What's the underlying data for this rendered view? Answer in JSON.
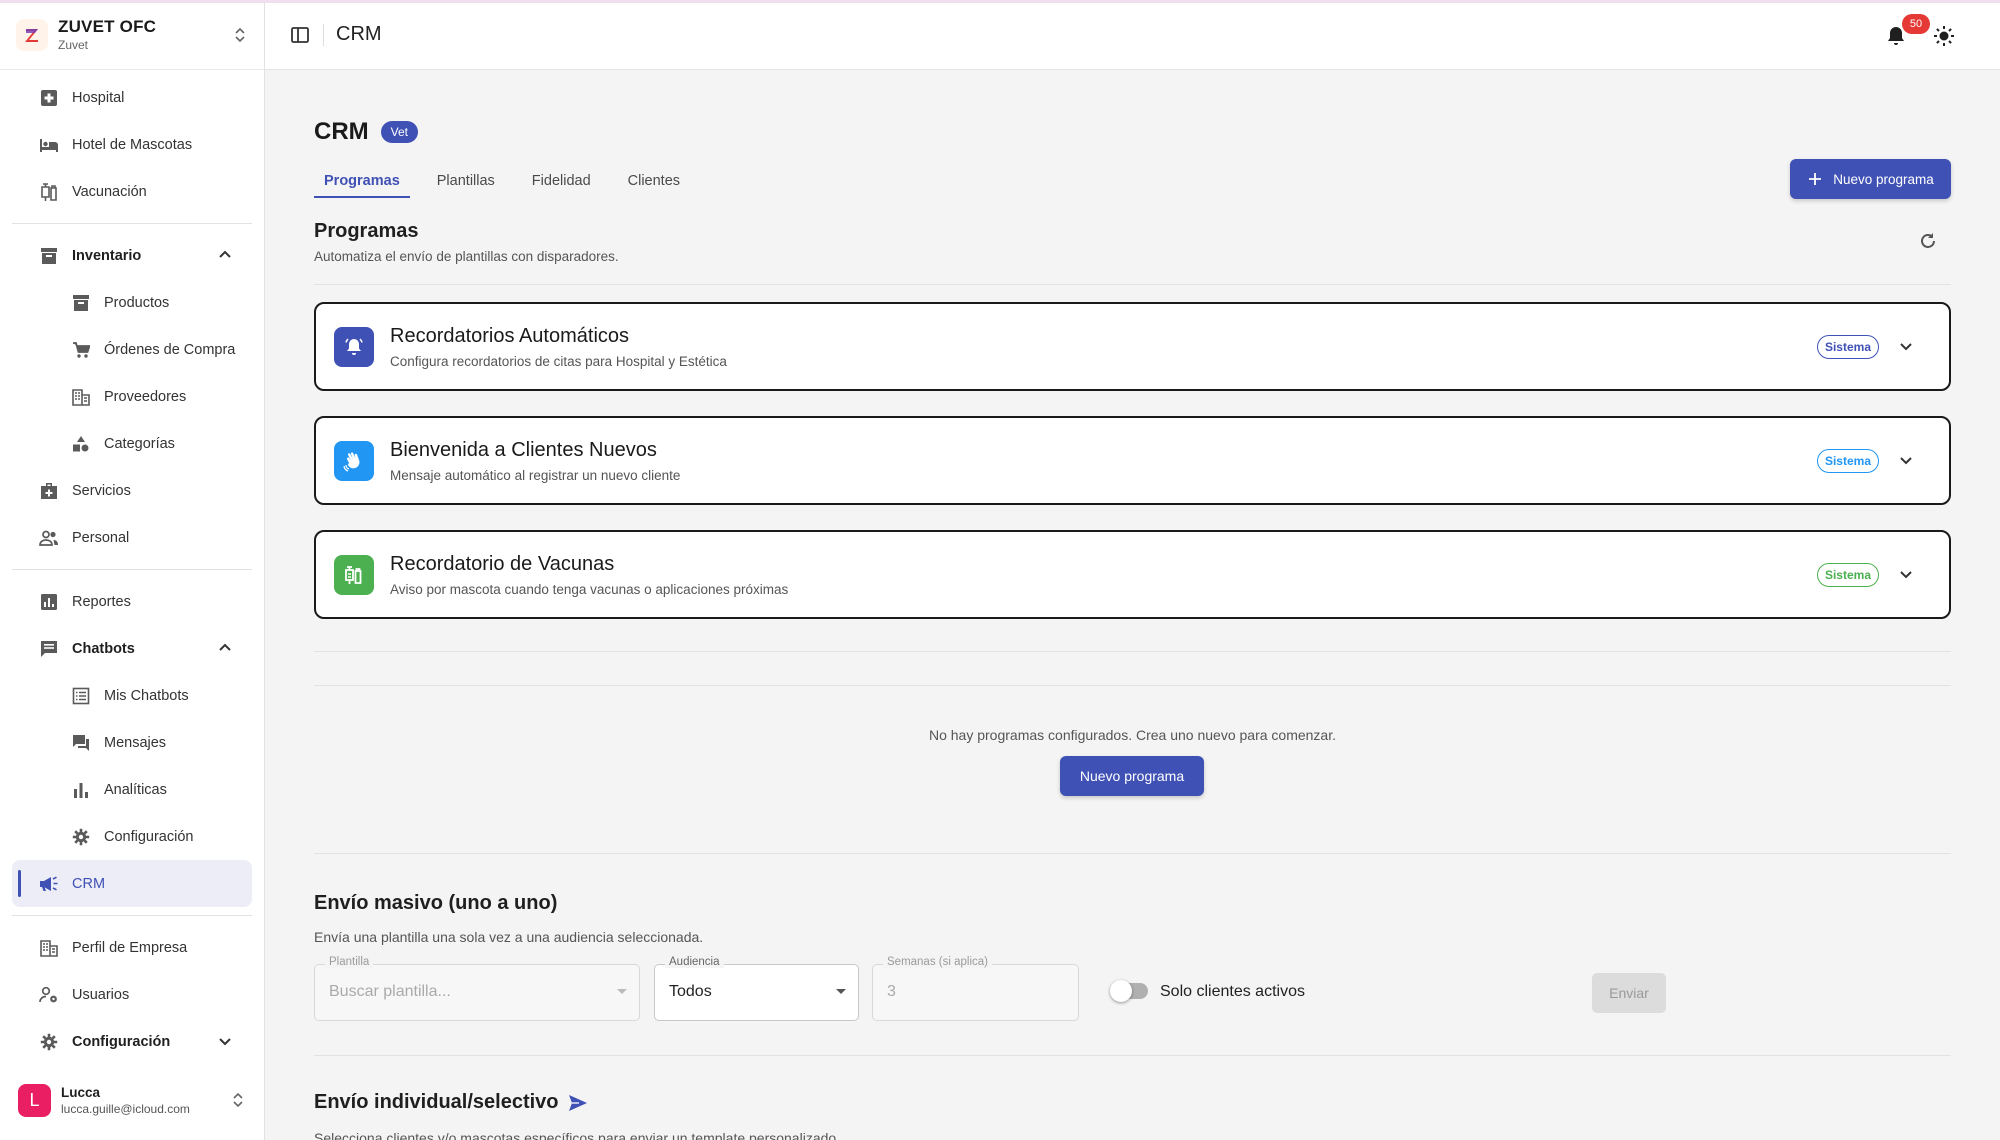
{
  "org": {
    "name": "ZUVET OFC",
    "sub": "Zuvet"
  },
  "sidebar": {
    "items": [
      {
        "label": "Hospital"
      },
      {
        "label": "Hotel de Mascotas"
      },
      {
        "label": "Vacunación"
      },
      {
        "label": "Inventario"
      },
      {
        "label": "Productos"
      },
      {
        "label": "Órdenes de Compra"
      },
      {
        "label": "Proveedores"
      },
      {
        "label": "Categorías"
      },
      {
        "label": "Servicios"
      },
      {
        "label": "Personal"
      },
      {
        "label": "Reportes"
      },
      {
        "label": "Chatbots"
      },
      {
        "label": "Mis Chatbots"
      },
      {
        "label": "Mensajes"
      },
      {
        "label": "Analíticas"
      },
      {
        "label": "Configuración"
      },
      {
        "label": "CRM"
      },
      {
        "label": "Perfil de Empresa"
      },
      {
        "label": "Usuarios"
      },
      {
        "label": "Configuración"
      }
    ]
  },
  "user": {
    "initial": "L",
    "name": "Lucca",
    "email": "lucca.guille@icloud.com"
  },
  "topbar": {
    "title": "CRM",
    "notifications": "50"
  },
  "page": {
    "title": "CRM",
    "chip": "Vet",
    "tabs": [
      "Programas",
      "Plantillas",
      "Fidelidad",
      "Clientes"
    ],
    "new_button": "Nuevo programa"
  },
  "programs": {
    "title": "Programas",
    "subtitle": "Automatiza el envío de plantillas con disparadores.",
    "cards": [
      {
        "title": "Recordatorios Automáticos",
        "subtitle": "Configura recordatorios de citas para Hospital y Estética",
        "chip": "Sistema",
        "color": "#3f51b5"
      },
      {
        "title": "Bienvenida a Clientes Nuevos",
        "subtitle": "Mensaje automático al registrar un nuevo cliente",
        "chip": "Sistema",
        "color": "#2196f3"
      },
      {
        "title": "Recordatorio de Vacunas",
        "subtitle": "Aviso por mascota cuando tenga vacunas o aplicaciones próximas",
        "chip": "Sistema",
        "color": "#4caf50"
      }
    ],
    "empty_text": "No hay programas configurados. Crea uno nuevo para comenzar.",
    "empty_button": "Nuevo programa"
  },
  "mass": {
    "title": "Envío masivo (uno a uno)",
    "subtitle": "Envía una plantilla una sola vez a una audiencia seleccionada.",
    "template_label": "Plantilla",
    "template_placeholder": "Buscar plantilla...",
    "audience_label": "Audiencia",
    "audience_value": "Todos",
    "weeks_label": "Semanas (si aplica)",
    "weeks_value": "3",
    "toggle_label": "Solo clientes activos",
    "send": "Enviar"
  },
  "individual": {
    "title": "Envío individual/selectivo",
    "subtitle": "Selecciona clientes y/o mascotas específicos para enviar un template personalizado."
  },
  "colors": {
    "accent": "#3f51b5",
    "danger": "#e53935",
    "success": "#4caf50",
    "info": "#2196f3"
  }
}
